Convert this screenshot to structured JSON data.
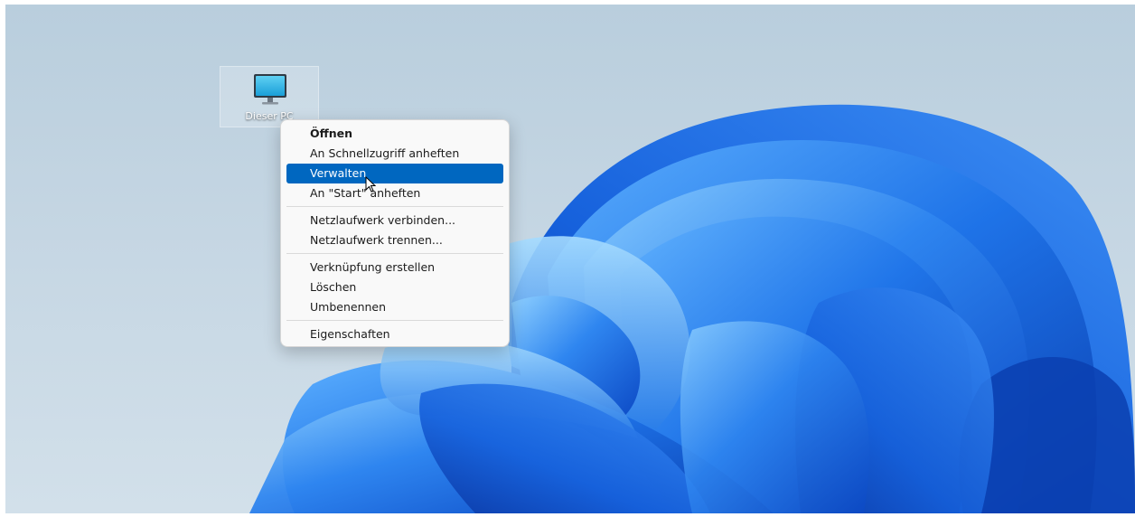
{
  "desktop": {
    "icon": {
      "label": "Dieser PC",
      "icon_name": "monitor-icon"
    },
    "accent_color": "#0067c0"
  },
  "context_menu": {
    "groups": [
      [
        {
          "label": "Öffnen",
          "bold": true
        },
        {
          "label": "An Schnellzugriff anheften"
        },
        {
          "label": "Verwalten",
          "active": true
        },
        {
          "label": "An \"Start\" anheften"
        }
      ],
      [
        {
          "label": "Netzlaufwerk verbinden..."
        },
        {
          "label": "Netzlaufwerk trennen..."
        }
      ],
      [
        {
          "label": "Verknüpfung erstellen"
        },
        {
          "label": "Löschen"
        },
        {
          "label": "Umbenennen"
        }
      ],
      [
        {
          "label": "Eigenschaften"
        }
      ]
    ]
  }
}
